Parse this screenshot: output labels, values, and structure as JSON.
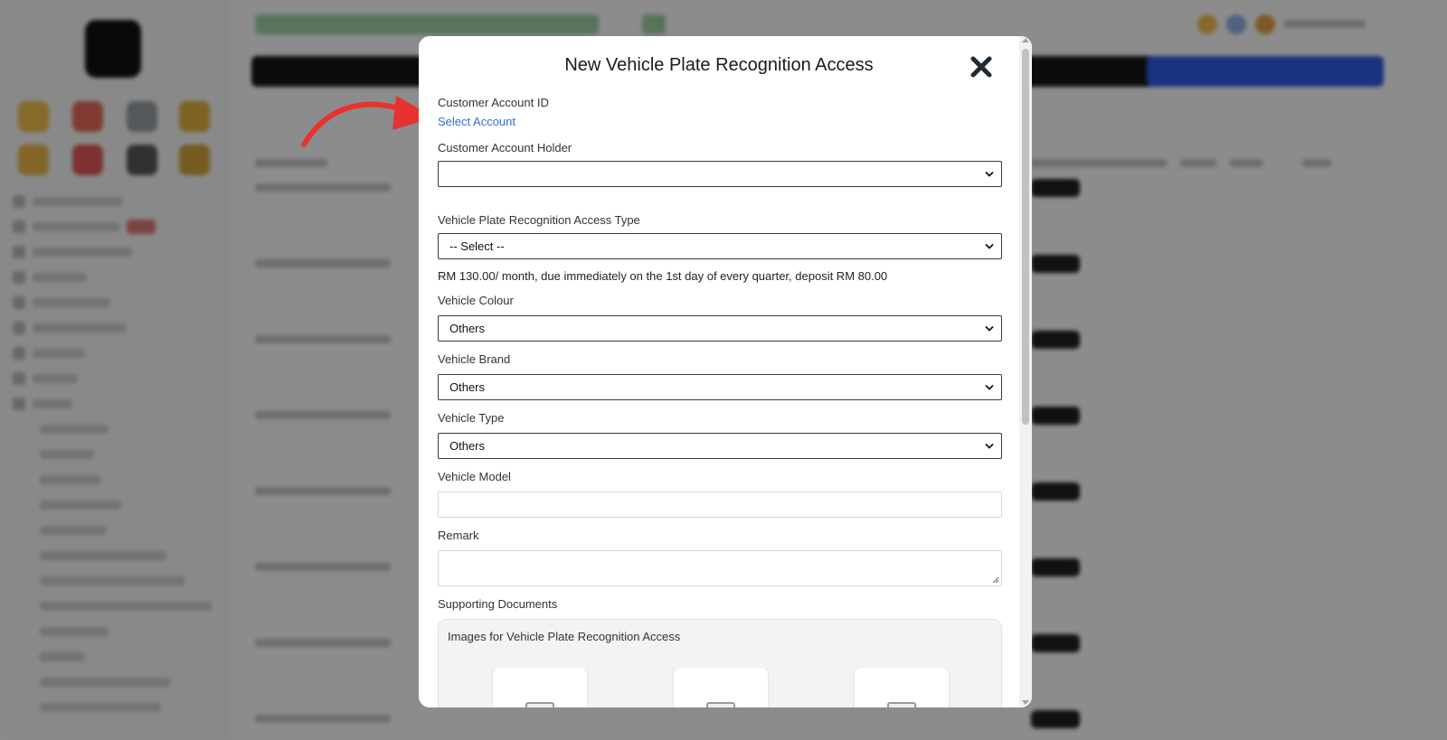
{
  "modal": {
    "title": "New Vehicle Plate Recognition Access",
    "close_icon": "close-x-icon",
    "fields": {
      "customer_account_id": {
        "label": "Customer Account ID",
        "link_text": "Select Account"
      },
      "customer_account_holder": {
        "label": "Customer Account Holder",
        "value": ""
      },
      "access_type": {
        "label": "Vehicle Plate Recognition Access Type",
        "value": "-- Select --"
      },
      "pricing_note": "RM 130.00/ month, due immediately on the 1st day of every quarter, deposit RM 80.00",
      "vehicle_colour": {
        "label": "Vehicle Colour",
        "value": "Others"
      },
      "vehicle_brand": {
        "label": "Vehicle Brand",
        "value": "Others"
      },
      "vehicle_type": {
        "label": "Vehicle Type",
        "value": "Others"
      },
      "vehicle_model": {
        "label": "Vehicle Model",
        "value": ""
      },
      "remark": {
        "label": "Remark",
        "value": ""
      }
    },
    "supporting_documents": {
      "label": "Supporting Documents",
      "box_title": "Images for Vehicle Plate Recognition Access",
      "upload_slot_icon": "image-placeholder-icon"
    }
  },
  "annotation": {
    "icon": "red-curved-arrow-icon",
    "color": "#e8322f"
  },
  "colors": {
    "link": "#2f6fd1",
    "overlay": "rgba(0,0,0,0.45)",
    "bg_title_green": "#9fd3a6",
    "bg_blue_button": "#2f5bea"
  }
}
